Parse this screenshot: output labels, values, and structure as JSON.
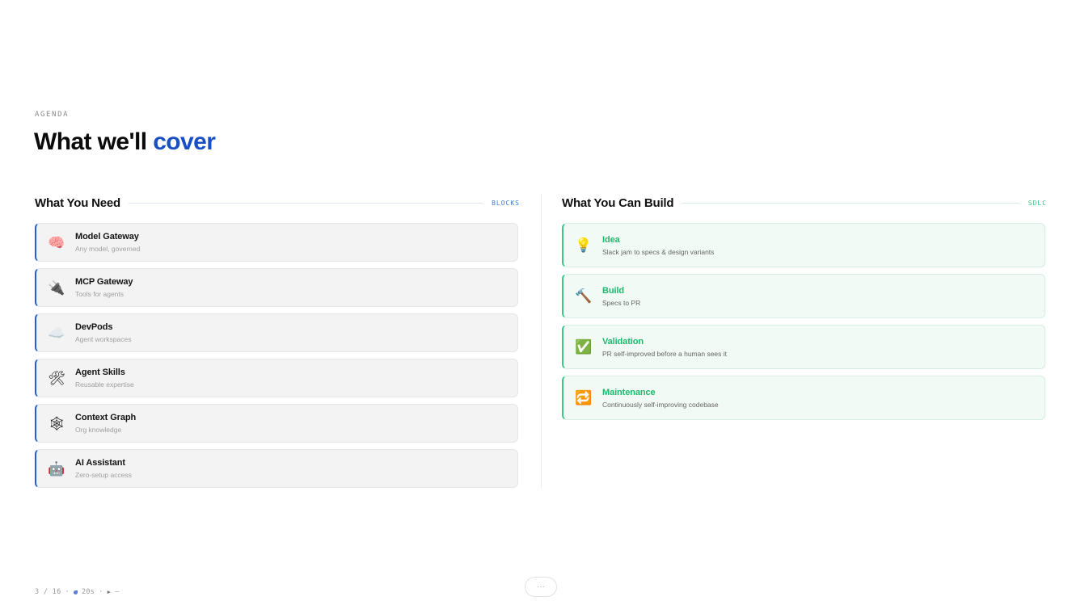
{
  "header": {
    "eyebrow": "AGENDA",
    "title_main": "What we'll ",
    "title_accent": "cover"
  },
  "left": {
    "heading": "What You Need",
    "tag": "BLOCKS",
    "items": [
      {
        "title": "Model Gateway",
        "subtitle": "Any model, governed",
        "icon": "brain-icon",
        "glyph": "🧠"
      },
      {
        "title": "MCP Gateway",
        "subtitle": "Tools for agents",
        "icon": "plug-icon",
        "glyph": "🔌"
      },
      {
        "title": "DevPods",
        "subtitle": "Agent workspaces",
        "icon": "cloud-icon",
        "glyph": "☁️"
      },
      {
        "title": "Agent Skills",
        "subtitle": "Reusable expertise",
        "icon": "tools-icon",
        "glyph": "🛠"
      },
      {
        "title": "Context Graph",
        "subtitle": "Org knowledge",
        "icon": "web-icon",
        "glyph": "🕸"
      },
      {
        "title": "AI Assistant",
        "subtitle": "Zero-setup access",
        "icon": "robot-icon",
        "glyph": "🤖"
      }
    ]
  },
  "right": {
    "heading": "What You Can Build",
    "tag": "SDLC",
    "items": [
      {
        "title": "Idea",
        "subtitle": "Slack jam to specs & design variants",
        "icon": "lightbulb-icon",
        "glyph": "💡"
      },
      {
        "title": "Build",
        "subtitle": "Specs to PR",
        "icon": "hammer-icon",
        "glyph": "🔨"
      },
      {
        "title": "Validation",
        "subtitle": "PR self-improved before a human sees it",
        "icon": "check-icon",
        "glyph": "✅"
      },
      {
        "title": "Maintenance",
        "subtitle": "Continuously self-improving codebase",
        "icon": "repeat-icon",
        "glyph": "🔁"
      }
    ]
  },
  "footer": {
    "page": "3 / 16",
    "sep1": "·",
    "timer": "20s",
    "sep2": "·",
    "play": "▶",
    "dash": "—"
  },
  "more_button": {
    "label": "···"
  },
  "colors": {
    "accent": "#1a4fc4",
    "need_border": "#2a5bd7",
    "build_green": "#1fb86e"
  }
}
